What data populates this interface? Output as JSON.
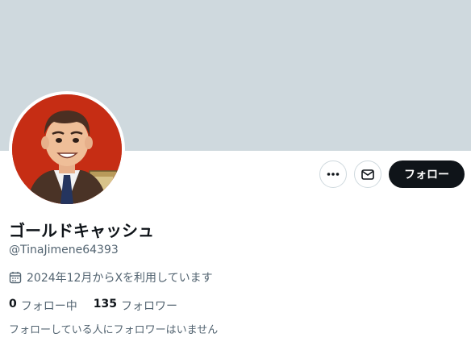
{
  "profile": {
    "display_name": "ゴールドキャッシュ",
    "handle": "@TinaJimene64393",
    "joined": "2024年12月からXを利用しています",
    "following_count": "0",
    "following_label": "フォロー中",
    "followers_count": "135",
    "followers_label": "フォロワー",
    "followed_by_text": "フォローしている人にフォロワーはいません"
  },
  "actions": {
    "more_icon": "more-horizontal-icon",
    "message_icon": "envelope-icon",
    "follow_label": "フォロー"
  },
  "colors": {
    "banner": "#cfd9de",
    "avatar_bg": "#c62d14",
    "follow_button": "#0f1419",
    "secondary_text": "#536471"
  }
}
